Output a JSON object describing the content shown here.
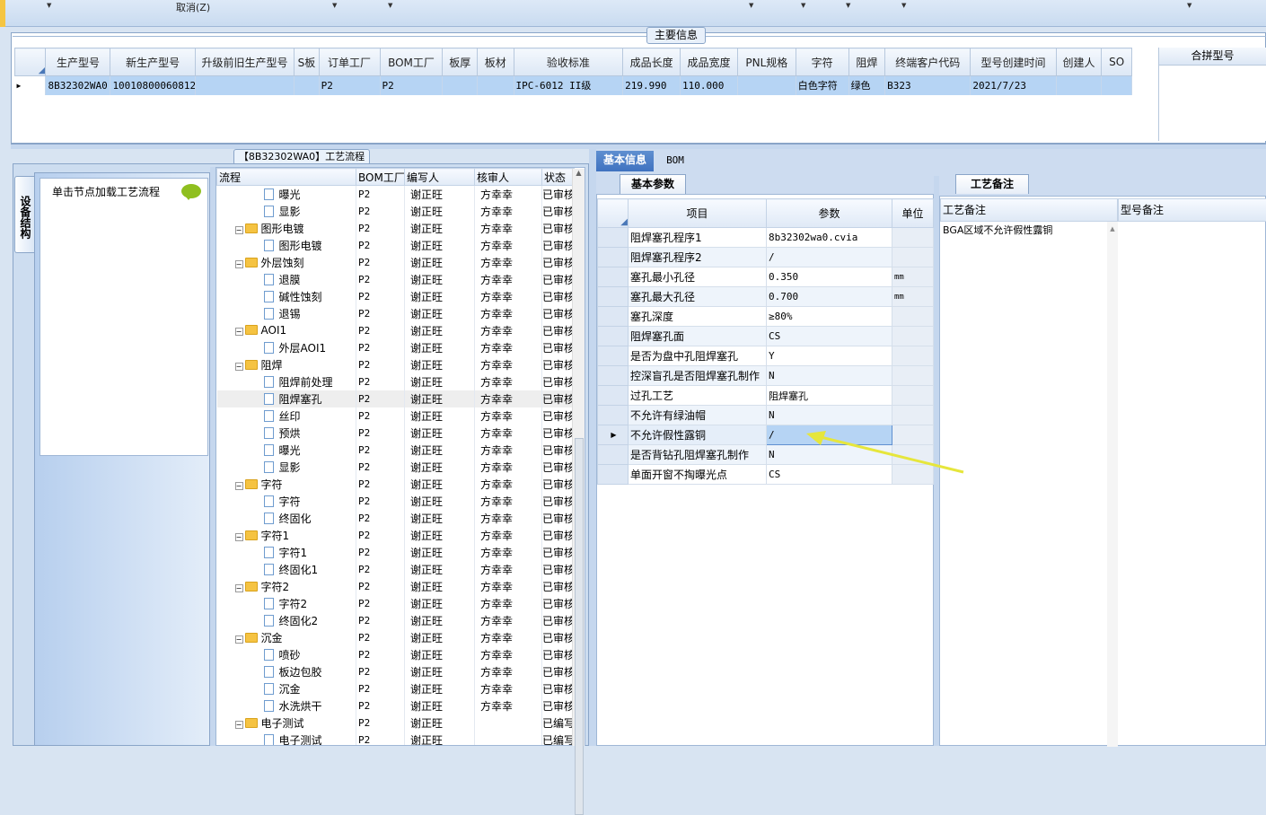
{
  "toolbar": {
    "cancel_label": "取消(Z)"
  },
  "main_info": {
    "title": "主要信息",
    "columns": [
      "生产型号",
      "新生产型号",
      "升级前旧生产型号",
      "S板",
      "订单工厂",
      "BOM工厂",
      "板厚",
      "板材",
      "验收标准",
      "成品长度",
      "成品宽度",
      "PNL规格",
      "字符",
      "阻焊",
      "终端客户代码",
      "型号创建时间",
      "创建人",
      "SO"
    ],
    "row": [
      "8B32302WA0",
      "10010800060812",
      "",
      "",
      "P2",
      "P2",
      "",
      "",
      "IPC-6012 II级",
      "219.990",
      "110.000",
      "",
      "白色字符",
      "绿色",
      "B323",
      "2021/7/23",
      "",
      ""
    ],
    "merge_header": "合拼型号"
  },
  "process": {
    "title": "【8B32302WA0】工艺流程",
    "side_tab": "设备结构",
    "node_hint": "单击节点加载工艺流程",
    "columns": [
      "流程",
      "BOM工厂",
      "编写人",
      "核审人",
      "状态"
    ],
    "rows": [
      {
        "name": "曝光",
        "level": 2,
        "type": "doc",
        "factory": "P2",
        "writer": "谢正旺",
        "reviewer": "方幸幸",
        "status": "已审核"
      },
      {
        "name": "显影",
        "level": 2,
        "type": "doc",
        "factory": "P2",
        "writer": "谢正旺",
        "reviewer": "方幸幸",
        "status": "已审核"
      },
      {
        "name": "图形电镀",
        "level": 1,
        "type": "folder",
        "factory": "P2",
        "writer": "谢正旺",
        "reviewer": "方幸幸",
        "status": "已审核"
      },
      {
        "name": "图形电镀",
        "level": 2,
        "type": "doc",
        "factory": "P2",
        "writer": "谢正旺",
        "reviewer": "方幸幸",
        "status": "已审核"
      },
      {
        "name": "外层蚀刻",
        "level": 1,
        "type": "folder",
        "factory": "P2",
        "writer": "谢正旺",
        "reviewer": "方幸幸",
        "status": "已审核"
      },
      {
        "name": "退膜",
        "level": 2,
        "type": "doc",
        "factory": "P2",
        "writer": "谢正旺",
        "reviewer": "方幸幸",
        "status": "已审核"
      },
      {
        "name": "碱性蚀刻",
        "level": 2,
        "type": "doc",
        "factory": "P2",
        "writer": "谢正旺",
        "reviewer": "方幸幸",
        "status": "已审核"
      },
      {
        "name": "退锡",
        "level": 2,
        "type": "doc",
        "factory": "P2",
        "writer": "谢正旺",
        "reviewer": "方幸幸",
        "status": "已审核"
      },
      {
        "name": "AOI1",
        "level": 1,
        "type": "folder",
        "factory": "P2",
        "writer": "谢正旺",
        "reviewer": "方幸幸",
        "status": "已审核"
      },
      {
        "name": "外层AOI1",
        "level": 2,
        "type": "doc",
        "factory": "P2",
        "writer": "谢正旺",
        "reviewer": "方幸幸",
        "status": "已审核"
      },
      {
        "name": "阻焊",
        "level": 1,
        "type": "folder",
        "factory": "P2",
        "writer": "谢正旺",
        "reviewer": "方幸幸",
        "status": "已审核"
      },
      {
        "name": "阻焊前处理",
        "level": 2,
        "type": "doc",
        "factory": "P2",
        "writer": "谢正旺",
        "reviewer": "方幸幸",
        "status": "已审核"
      },
      {
        "name": "阻焊塞孔",
        "level": 2,
        "type": "doc",
        "factory": "P2",
        "writer": "谢正旺",
        "reviewer": "方幸幸",
        "status": "已审核",
        "selected": true
      },
      {
        "name": "丝印",
        "level": 2,
        "type": "doc",
        "factory": "P2",
        "writer": "谢正旺",
        "reviewer": "方幸幸",
        "status": "已审核"
      },
      {
        "name": "预烘",
        "level": 2,
        "type": "doc",
        "factory": "P2",
        "writer": "谢正旺",
        "reviewer": "方幸幸",
        "status": "已审核"
      },
      {
        "name": "曝光",
        "level": 2,
        "type": "doc",
        "factory": "P2",
        "writer": "谢正旺",
        "reviewer": "方幸幸",
        "status": "已审核"
      },
      {
        "name": "显影",
        "level": 2,
        "type": "doc",
        "factory": "P2",
        "writer": "谢正旺",
        "reviewer": "方幸幸",
        "status": "已审核"
      },
      {
        "name": "字符",
        "level": 1,
        "type": "folder",
        "factory": "P2",
        "writer": "谢正旺",
        "reviewer": "方幸幸",
        "status": "已审核"
      },
      {
        "name": "字符",
        "level": 2,
        "type": "doc",
        "factory": "P2",
        "writer": "谢正旺",
        "reviewer": "方幸幸",
        "status": "已审核"
      },
      {
        "name": "终固化",
        "level": 2,
        "type": "doc",
        "factory": "P2",
        "writer": "谢正旺",
        "reviewer": "方幸幸",
        "status": "已审核"
      },
      {
        "name": "字符1",
        "level": 1,
        "type": "folder",
        "factory": "P2",
        "writer": "谢正旺",
        "reviewer": "方幸幸",
        "status": "已审核"
      },
      {
        "name": "字符1",
        "level": 2,
        "type": "doc",
        "factory": "P2",
        "writer": "谢正旺",
        "reviewer": "方幸幸",
        "status": "已审核"
      },
      {
        "name": "终固化1",
        "level": 2,
        "type": "doc",
        "factory": "P2",
        "writer": "谢正旺",
        "reviewer": "方幸幸",
        "status": "已审核"
      },
      {
        "name": "字符2",
        "level": 1,
        "type": "folder",
        "factory": "P2",
        "writer": "谢正旺",
        "reviewer": "方幸幸",
        "status": "已审核"
      },
      {
        "name": "字符2",
        "level": 2,
        "type": "doc",
        "factory": "P2",
        "writer": "谢正旺",
        "reviewer": "方幸幸",
        "status": "已审核"
      },
      {
        "name": "终固化2",
        "level": 2,
        "type": "doc",
        "factory": "P2",
        "writer": "谢正旺",
        "reviewer": "方幸幸",
        "status": "已审核"
      },
      {
        "name": "沉金",
        "level": 1,
        "type": "folder",
        "factory": "P2",
        "writer": "谢正旺",
        "reviewer": "方幸幸",
        "status": "已审核"
      },
      {
        "name": "喷砂",
        "level": 2,
        "type": "doc",
        "factory": "P2",
        "writer": "谢正旺",
        "reviewer": "方幸幸",
        "status": "已审核"
      },
      {
        "name": "板边包胶",
        "level": 2,
        "type": "doc",
        "factory": "P2",
        "writer": "谢正旺",
        "reviewer": "方幸幸",
        "status": "已审核"
      },
      {
        "name": "沉金",
        "level": 2,
        "type": "doc",
        "factory": "P2",
        "writer": "谢正旺",
        "reviewer": "方幸幸",
        "status": "已审核"
      },
      {
        "name": "水洗烘干",
        "level": 2,
        "type": "doc",
        "factory": "P2",
        "writer": "谢正旺",
        "reviewer": "方幸幸",
        "status": "已审核"
      },
      {
        "name": "电子测试",
        "level": 1,
        "type": "folder",
        "factory": "P2",
        "writer": "谢正旺",
        "reviewer": "",
        "status": "已编写"
      },
      {
        "name": "电子测试",
        "level": 2,
        "type": "doc",
        "factory": "P2",
        "writer": "谢正旺",
        "reviewer": "",
        "status": "已编写"
      }
    ]
  },
  "detail": {
    "tabs": [
      "基本信息",
      "BOM"
    ],
    "sub_tab": "基本参数",
    "columns": [
      "项目",
      "参数",
      "单位"
    ],
    "rows": [
      {
        "item": "阻焊塞孔程序1",
        "value": "8b32302wa0.cvia",
        "unit": ""
      },
      {
        "item": "阻焊塞孔程序2",
        "value": "/",
        "unit": ""
      },
      {
        "item": "塞孔最小孔径",
        "value": "0.350",
        "unit": "mm"
      },
      {
        "item": "塞孔最大孔径",
        "value": "0.700",
        "unit": "mm"
      },
      {
        "item": "塞孔深度",
        "value": "≥80%",
        "unit": ""
      },
      {
        "item": "阻焊塞孔面",
        "value": "CS",
        "unit": ""
      },
      {
        "item": "是否为盘中孔阻焊塞孔",
        "value": "Y",
        "unit": ""
      },
      {
        "item": "控深盲孔是否阻焊塞孔制作",
        "value": "N",
        "unit": ""
      },
      {
        "item": "过孔工艺",
        "value": "阻焊塞孔",
        "unit": ""
      },
      {
        "item": "不允许有绿油帽",
        "value": "N",
        "unit": ""
      },
      {
        "item": "不允许假性露铜",
        "value": "/",
        "unit": "",
        "current": true
      },
      {
        "item": "是否背钻孔阻焊塞孔制作",
        "value": "N",
        "unit": ""
      },
      {
        "item": "单面开窗不掏曝光点",
        "value": "CS",
        "unit": ""
      }
    ]
  },
  "remarks": {
    "tab": "工艺备注",
    "col1": "工艺备注",
    "col2": "型号备注",
    "text": "BGA区域不允许假性露铜"
  },
  "colors": {
    "selection": "#b6d4f4",
    "tab_active": "#3f72c0",
    "arrow": "#e6e63c"
  }
}
